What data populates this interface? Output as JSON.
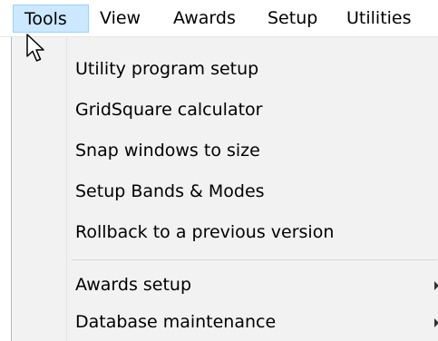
{
  "menubar": {
    "items": [
      {
        "label": "Tools",
        "active": true
      },
      {
        "label": "View"
      },
      {
        "label": "Awards"
      },
      {
        "label": "Setup"
      },
      {
        "label": "Utilities"
      }
    ]
  },
  "dropdown": {
    "items": [
      {
        "label": "Utility program setup"
      },
      {
        "label": "GridSquare calculator"
      },
      {
        "label": "Snap windows to size"
      },
      {
        "label": "Setup Bands & Modes"
      },
      {
        "label": "Rollback to a previous version"
      },
      {
        "label": "Awards setup",
        "submenu": true
      },
      {
        "label": "Database maintenance",
        "submenu": true
      }
    ]
  },
  "colors": {
    "active_menu_bg": "#cce8ff",
    "active_menu_border": "#99d1ff",
    "dropdown_bg": "#f2f2f2"
  },
  "icons": {
    "cursor": "mouse-pointer-icon",
    "submenu": "chevron-right-icon"
  }
}
